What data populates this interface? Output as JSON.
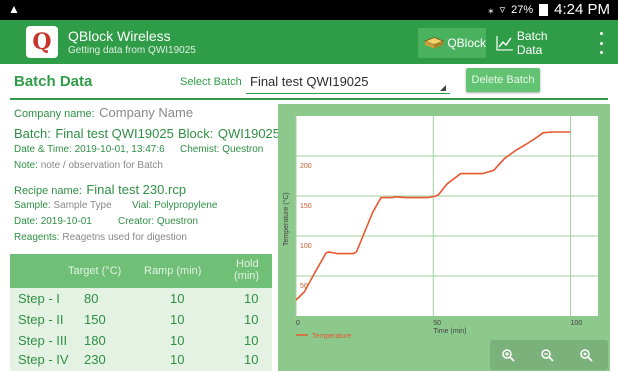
{
  "status_bar": {
    "time": "4:24 PM",
    "battery": "27%"
  },
  "app_bar": {
    "title": "QBlock Wireless",
    "subtitle": "Getting data from QWI19025",
    "qblock_label": "QBlock",
    "batch_data_label": "Batch Data"
  },
  "header": {
    "title": "Batch Data",
    "select_label": "Select Batch",
    "select_value": "Final test QWI19025",
    "delete_label": "Delete Batch"
  },
  "details": {
    "company_label": "Company name:",
    "company_value": "Company Name",
    "batch_label": "Batch:",
    "batch_value": "Final test QWI19025",
    "block_label": "Block:",
    "block_value": "QWI19025",
    "datetime_label": "Date & Time:",
    "datetime_value": "2019-10-01, 13:47:6",
    "chemist_label": "Chemist:",
    "chemist_value": "Questron",
    "note_label": "Note:",
    "note_value": "note / observation for Batch",
    "recipe_label": "Recipe name:",
    "recipe_value": "Final test 230.rcp",
    "sample_label": "Sample:",
    "sample_value": "Sample Type",
    "vial_label": "Vial:",
    "vial_value": "Polypropylene",
    "date_label": "Date:",
    "date_value": "2019-10-01",
    "creator_label": "Creator:",
    "creator_value": "Questron",
    "reagents_label": "Reagents:",
    "reagents_value": "Reagetns used for digestion"
  },
  "steps_table": {
    "col_target": "Target (°C)",
    "col_ramp": "Ramp (min)",
    "col_hold_1": "Hold",
    "col_hold_2": "(min)",
    "rows": [
      {
        "step": "Step - I",
        "target": "80",
        "ramp": "10",
        "hold": "10"
      },
      {
        "step": "Step - II",
        "target": "150",
        "ramp": "10",
        "hold": "10"
      },
      {
        "step": "Step - III",
        "target": "180",
        "ramp": "10",
        "hold": "10"
      },
      {
        "step": "Step - IV",
        "target": "230",
        "ramp": "10",
        "hold": "10"
      }
    ]
  },
  "chart_data": {
    "type": "line",
    "title": "",
    "xlabel": "Time (min)",
    "ylabel": "Temperature (°C)",
    "xlim": [
      0,
      110
    ],
    "ylim": [
      0,
      250
    ],
    "x_ticks": [
      "0",
      "50",
      "100"
    ],
    "y_ticks": [
      "50",
      "100",
      "150",
      "200"
    ],
    "legend": "bottom-left",
    "grid": true,
    "series": [
      {
        "name": "Temperature",
        "color": "#e8572f",
        "x": [
          0,
          3,
          7,
          11,
          12,
          15,
          18,
          21,
          22,
          25,
          28,
          31,
          35,
          36,
          40,
          44,
          48,
          51,
          52,
          55,
          60,
          64,
          66,
          68,
          72,
          76,
          80,
          84,
          88,
          90,
          93,
          96,
          100
        ],
        "y": [
          20,
          30,
          55,
          79,
          80,
          78,
          78,
          78,
          80,
          105,
          130,
          148,
          148,
          149,
          148,
          148,
          148,
          150,
          152,
          165,
          178,
          178,
          178,
          178,
          182,
          197,
          207,
          215,
          224,
          229,
          230,
          230,
          230
        ]
      }
    ]
  }
}
